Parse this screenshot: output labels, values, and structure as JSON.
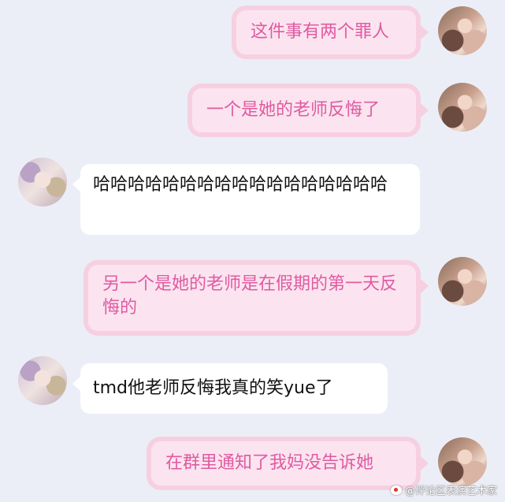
{
  "messages": [
    {
      "sender": "me",
      "text": "这件事有两个罪人"
    },
    {
      "sender": "me",
      "text": "一个是她的老师反悔了"
    },
    {
      "sender": "them",
      "text": "哈哈哈哈哈哈哈哈哈哈哈哈哈哈哈哈哈"
    },
    {
      "sender": "me",
      "text": "另一个是她的老师是在假期的第一天反悔的"
    },
    {
      "sender": "them",
      "text": "tmd他老师反悔我真的笑yue了"
    },
    {
      "sender": "me",
      "text": "在群里通知了我妈没告诉她"
    }
  ],
  "watermark": "@评论区表演艺术家",
  "colors": {
    "background": "#eceef7",
    "me_bubble": "#fbe4ef",
    "me_text": "#e05aa2",
    "them_bubble": "#ffffff",
    "them_text": "#111111"
  }
}
